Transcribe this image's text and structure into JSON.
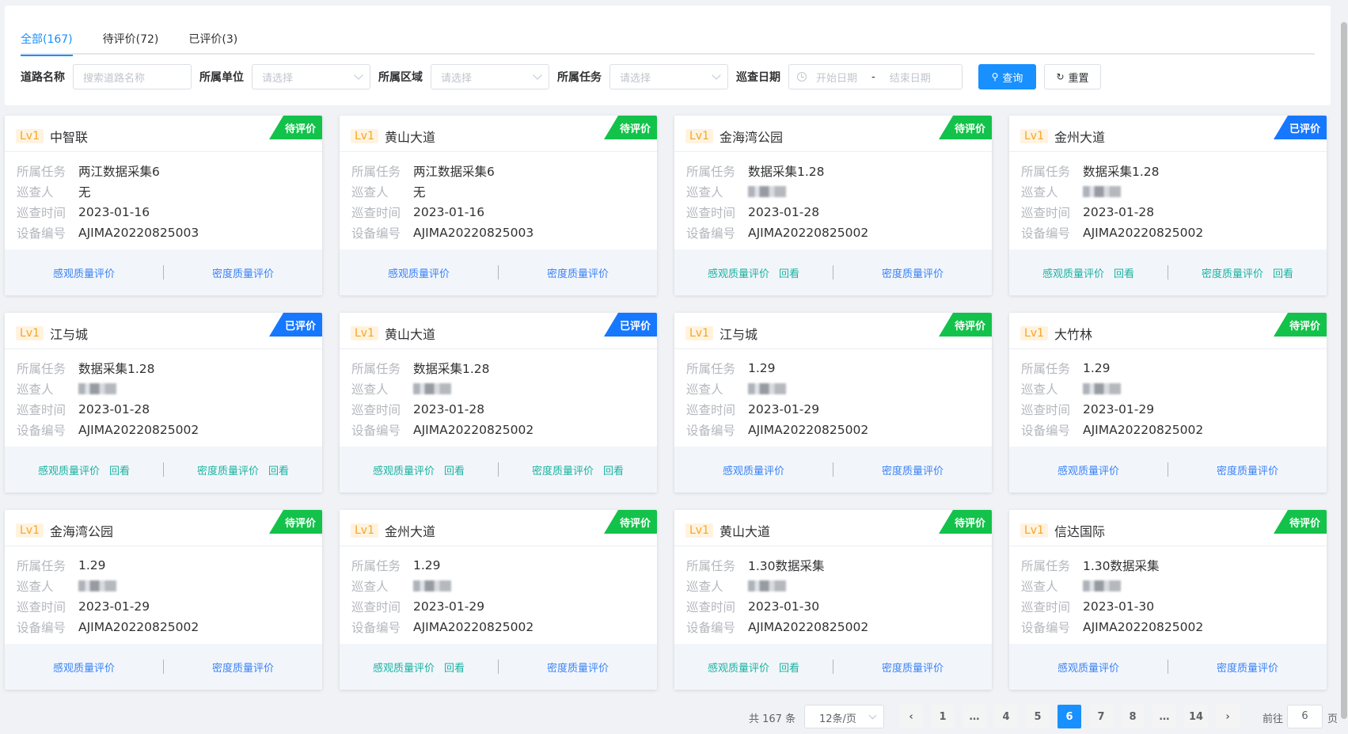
{
  "tabs": [
    {
      "label": "全部(167)",
      "active": true
    },
    {
      "label": "待评价(72)",
      "active": false
    },
    {
      "label": "已评价(3)",
      "active": false
    }
  ],
  "filters": {
    "road_label": "道路名称",
    "road_placeholder": "搜索道路名称",
    "unit_label": "所属单位",
    "unit_placeholder": "请选择",
    "area_label": "所属区域",
    "area_placeholder": "请选择",
    "task_label": "所属任务",
    "task_placeholder": "请选择",
    "date_label": "巡查日期",
    "date_start_placeholder": "开始日期",
    "date_sep": "-",
    "date_end_placeholder": "结束日期",
    "query_label": "查询",
    "reset_label": "重置"
  },
  "field_labels": {
    "task": "所属任务",
    "inspector": "巡查人",
    "time": "巡查时间",
    "device": "设备编号"
  },
  "actions": {
    "visual": "感观质量评价",
    "density": "密度质量评价",
    "review": "回看"
  },
  "cards": [
    {
      "level": "Lv1",
      "road": "中智联",
      "status": "待评价",
      "status_type": "pending",
      "task": "两江数据采集6",
      "inspector": "无",
      "inspector_blurred": false,
      "time": "2023-01-16",
      "device": "AJIMA20220825003",
      "visual_review": false,
      "density_review": false
    },
    {
      "level": "Lv1",
      "road": "黄山大道",
      "status": "待评价",
      "status_type": "pending",
      "task": "两江数据采集6",
      "inspector": "无",
      "inspector_blurred": false,
      "time": "2023-01-16",
      "device": "AJIMA20220825003",
      "visual_review": false,
      "density_review": false
    },
    {
      "level": "Lv1",
      "road": "金海湾公园",
      "status": "待评价",
      "status_type": "pending",
      "task": "数据采集1.28",
      "inspector": "",
      "inspector_blurred": true,
      "time": "2023-01-28",
      "device": "AJIMA20220825002",
      "visual_review": true,
      "density_review": false
    },
    {
      "level": "Lv1",
      "road": "金州大道",
      "status": "已评价",
      "status_type": "done",
      "task": "数据采集1.28",
      "inspector": "",
      "inspector_blurred": true,
      "time": "2023-01-28",
      "device": "AJIMA20220825002",
      "visual_review": true,
      "density_review": true
    },
    {
      "level": "Lv1",
      "road": "江与城",
      "status": "已评价",
      "status_type": "done",
      "task": "数据采集1.28",
      "inspector": "",
      "inspector_blurred": true,
      "time": "2023-01-28",
      "device": "AJIMA20220825002",
      "visual_review": true,
      "density_review": true
    },
    {
      "level": "Lv1",
      "road": "黄山大道",
      "status": "已评价",
      "status_type": "done",
      "task": "数据采集1.28",
      "inspector": "",
      "inspector_blurred": true,
      "time": "2023-01-28",
      "device": "AJIMA20220825002",
      "visual_review": true,
      "density_review": true
    },
    {
      "level": "Lv1",
      "road": "江与城",
      "status": "待评价",
      "status_type": "pending",
      "task": "1.29",
      "inspector": "",
      "inspector_blurred": true,
      "time": "2023-01-29",
      "device": "AJIMA20220825002",
      "visual_review": false,
      "density_review": false
    },
    {
      "level": "Lv1",
      "road": "大竹林",
      "status": "待评价",
      "status_type": "pending",
      "task": "1.29",
      "inspector": "",
      "inspector_blurred": true,
      "time": "2023-01-29",
      "device": "AJIMA20220825002",
      "visual_review": false,
      "density_review": false
    },
    {
      "level": "Lv1",
      "road": "金海湾公园",
      "status": "待评价",
      "status_type": "pending",
      "task": "1.29",
      "inspector": "",
      "inspector_blurred": true,
      "time": "2023-01-29",
      "device": "AJIMA20220825002",
      "visual_review": false,
      "density_review": false
    },
    {
      "level": "Lv1",
      "road": "金州大道",
      "status": "待评价",
      "status_type": "pending",
      "task": "1.29",
      "inspector": "",
      "inspector_blurred": true,
      "time": "2023-01-29",
      "device": "AJIMA20220825002",
      "visual_review": true,
      "density_review": false
    },
    {
      "level": "Lv1",
      "road": "黄山大道",
      "status": "待评价",
      "status_type": "pending",
      "task": "1.30数据采集",
      "inspector": "",
      "inspector_blurred": true,
      "time": "2023-01-30",
      "device": "AJIMA20220825002",
      "visual_review": true,
      "density_review": false
    },
    {
      "level": "Lv1",
      "road": "信达国际",
      "status": "待评价",
      "status_type": "pending",
      "task": "1.30数据采集",
      "inspector": "",
      "inspector_blurred": true,
      "time": "2023-01-30",
      "device": "AJIMA20220825002",
      "visual_review": false,
      "density_review": false
    }
  ],
  "pagination": {
    "total_text": "共 167 条",
    "page_size": "12条/页",
    "prev_icon": "chevron-left-icon",
    "next_icon": "chevron-right-icon",
    "pages": [
      "1",
      "…",
      "4",
      "5",
      "6",
      "7",
      "8",
      "…",
      "14"
    ],
    "current": "6",
    "goto_label": "前往",
    "goto_value": "6",
    "goto_suffix": "页"
  },
  "colors": {
    "primary": "#1890ff",
    "pending_badge": "#13c24a",
    "done_badge": "#1677ff",
    "level_tag": "#f5a623",
    "review_link": "#1ab2a0",
    "eval_link": "#3b82f6"
  }
}
